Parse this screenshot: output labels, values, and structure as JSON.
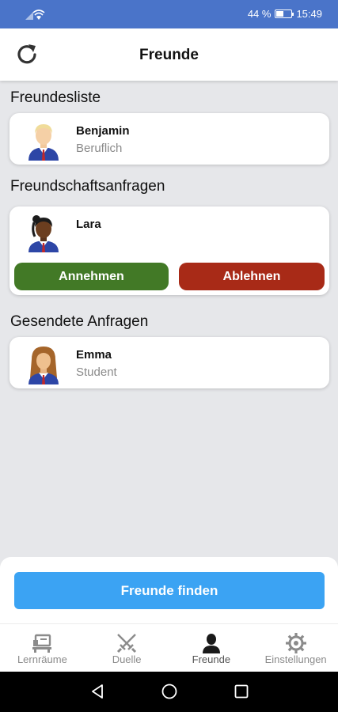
{
  "status": {
    "battery": "44 %",
    "time": "15:49",
    "battery_level": 0.44
  },
  "header": {
    "title": "Freunde",
    "refresh_icon": "refresh-icon"
  },
  "sections": {
    "friends": {
      "title": "Freundesliste",
      "items": [
        {
          "name": "Benjamin",
          "subtitle": "Beruflich",
          "avatar": "male-blond-avatar"
        }
      ]
    },
    "requests": {
      "title": "Freundschaftsanfragen",
      "items": [
        {
          "name": "Lara",
          "avatar": "female-dark-avatar",
          "accept_label": "Annehmen",
          "decline_label": "Ablehnen"
        }
      ]
    },
    "sent": {
      "title": "Gesendete Anfragen",
      "items": [
        {
          "name": "Emma",
          "subtitle": "Student",
          "avatar": "female-brown-avatar"
        }
      ]
    }
  },
  "find_button": "Freunde finden",
  "nav": {
    "items": [
      {
        "label": "Lernräume",
        "icon": "classroom-icon"
      },
      {
        "label": "Duelle",
        "icon": "swords-icon"
      },
      {
        "label": "Freunde",
        "icon": "person-icon",
        "active": true
      },
      {
        "label": "Einstellungen",
        "icon": "gear-icon"
      }
    ]
  },
  "colors": {
    "statusbar": "#4a74c9",
    "accept": "#427926",
    "decline": "#a82a17",
    "primary": "#3ba3f3",
    "background": "#e6e7ea"
  }
}
